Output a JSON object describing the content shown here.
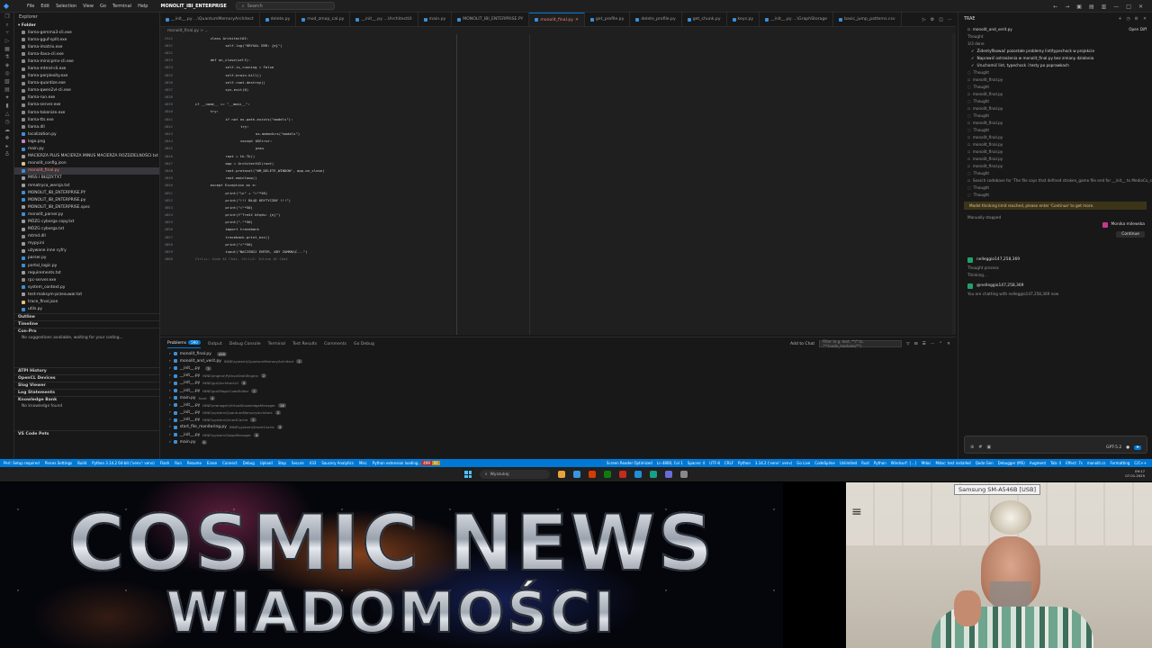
{
  "titlebar": {
    "menu": [
      "File",
      "Edit",
      "Selection",
      "View",
      "Go",
      "Terminal",
      "Help"
    ],
    "active_window": "MONOLIT_IBI_ENTERPRISE",
    "search_placeholder": "Search"
  },
  "explorer": {
    "header": "Explorer",
    "folder": "Folder",
    "files": [
      {
        "name": "llama-gemma3-cli.exe",
        "type": "exe"
      },
      {
        "name": "llama-gguf-split.exe",
        "type": "exe"
      },
      {
        "name": "llama-imatrix.exe",
        "type": "exe"
      },
      {
        "name": "llama-llava-cli.exe",
        "type": "exe"
      },
      {
        "name": "llama-minicpmv-cli.exe",
        "type": "exe"
      },
      {
        "name": "llama-mtmd-cli.exe",
        "type": "exe"
      },
      {
        "name": "llama-perplexity.exe",
        "type": "exe"
      },
      {
        "name": "llama-quantize.exe",
        "type": "exe"
      },
      {
        "name": "llama-qwen2vl-cli.exe",
        "type": "exe"
      },
      {
        "name": "llama-run.exe",
        "type": "exe"
      },
      {
        "name": "llama-server.exe",
        "type": "exe"
      },
      {
        "name": "llama-tokenize.exe",
        "type": "exe"
      },
      {
        "name": "llama-tts.exe",
        "type": "exe"
      },
      {
        "name": "llama.dll",
        "type": "exe"
      },
      {
        "name": "localization.py",
        "type": "py"
      },
      {
        "name": "logo.png",
        "type": "png"
      },
      {
        "name": "main.py",
        "type": "py"
      },
      {
        "name": "MACIERZA PLUS MACIERZA MINUS MACIERZA ROZDZIELNOŚCI.txt",
        "type": "txt"
      },
      {
        "name": "monolit_config.json",
        "type": "json"
      },
      {
        "name": "monolit_final.py",
        "type": "py",
        "selected": true
      },
      {
        "name": "MISS I BŁĘDY.TXT",
        "type": "txt"
      },
      {
        "name": "mmatryca_wersja.txt",
        "type": "txt"
      },
      {
        "name": "MONOLIT_IBI_ENTERPRISE.PY",
        "type": "py"
      },
      {
        "name": "MONOLIT_IBI_ENTERPRISE.py",
        "type": "py"
      },
      {
        "name": "MONOLIT_IBI_ENTERPRISE.spec",
        "type": "txt"
      },
      {
        "name": "monolit_parser.py",
        "type": "py"
      },
      {
        "name": "MÓZG cyborga copy.txt",
        "type": "txt"
      },
      {
        "name": "MÓZG cyborga.txt",
        "type": "txt"
      },
      {
        "name": "mtmd.dll",
        "type": "exe"
      },
      {
        "name": "mypy.ini",
        "type": "txt"
      },
      {
        "name": "używane inne cyfry",
        "type": "txt"
      },
      {
        "name": "parser.py",
        "type": "py"
      },
      {
        "name": "portal_logic.py",
        "type": "py"
      },
      {
        "name": "requirements.txt",
        "type": "txt"
      },
      {
        "name": "rpc-server.exe",
        "type": "exe"
      },
      {
        "name": "system_context.py",
        "type": "py"
      },
      {
        "name": "test-maksym-przesuwar.txt",
        "type": "txt"
      },
      {
        "name": "trace_final.json",
        "type": "json"
      },
      {
        "name": "utils.py",
        "type": "py"
      }
    ],
    "sections": [
      "Outline",
      "Timeline",
      "Con-Pro"
    ],
    "conpro_note": "No suggestions available, waiting for your coding...",
    "lower_sections": [
      "ATPI History",
      "OpenCL Devices",
      "Slog Viewer",
      "Log Statements",
      "Knowledge Bank"
    ],
    "knowledge_note": "No knowledge found",
    "bottom_section": "VS Code Pets"
  },
  "tabs": [
    {
      "label": "__init__.py  ...\\QuantumMemoryArchitect",
      "active": false
    },
    {
      "label": "delete.py",
      "active": false
    },
    {
      "label": "mod_zmap_cal.py",
      "active": false
    },
    {
      "label": "__init__.py  ...\\ArchitectUI",
      "active": false
    },
    {
      "label": "main.py",
      "active": false
    },
    {
      "label": "MONOLIT_IBI_ENTERPRISE.PY",
      "active": false
    },
    {
      "label": "monolit_final.py",
      "active": true
    },
    {
      "label": "get_profile.py",
      "active": false
    },
    {
      "label": "delete_profile.py",
      "active": false
    },
    {
      "label": "get_chunk.py",
      "active": false
    },
    {
      "label": "keys.py",
      "active": false
    },
    {
      "label": "__init__.py  ...\\GraphStorage",
      "active": false
    },
    {
      "label": "basic_jump_patterns.csv",
      "active": false
    }
  ],
  "breadcrumb": "monolit_final.py > ...",
  "code": [
    {
      "ln": "2542",
      "indent": 8,
      "text": "class ArchitectUI:"
    },
    {
      "ln": "4831",
      "indent": 12,
      "text": "self.log(\"KRYSAL ERR: {e}\")"
    },
    {
      "ln": "4832",
      "indent": 0,
      "text": ""
    },
    {
      "ln": "4833",
      "indent": 8,
      "text": "def on_close(self):"
    },
    {
      "ln": "4834",
      "indent": 12,
      "text": "self.is_running = False"
    },
    {
      "ln": "4835",
      "indent": 12,
      "text": "self.brain.kill()"
    },
    {
      "ln": "4836",
      "indent": 12,
      "text": "self.root.destroy()"
    },
    {
      "ln": "4837",
      "indent": 12,
      "text": "sys.exit(0)"
    },
    {
      "ln": "4838",
      "indent": 0,
      "text": ""
    },
    {
      "ln": "4839",
      "indent": 4,
      "text": "if __name__ == \"__main__\":"
    },
    {
      "ln": "4840",
      "indent": 8,
      "text": "try:"
    },
    {
      "ln": "4841",
      "indent": 12,
      "text": "if not os.path.exists(\"models\"):"
    },
    {
      "ln": "4842",
      "indent": 16,
      "text": "try:"
    },
    {
      "ln": "4843",
      "indent": 20,
      "text": "os.makedirs(\"models\")"
    },
    {
      "ln": "4844",
      "indent": 16,
      "text": "except OSError:"
    },
    {
      "ln": "4845",
      "indent": 20,
      "text": "pass"
    },
    {
      "ln": "4846",
      "indent": 12,
      "text": "root = tk.Tk()"
    },
    {
      "ln": "4847",
      "indent": 12,
      "text": "app = ArchitectUI(root)"
    },
    {
      "ln": "4848",
      "indent": 12,
      "text": "root.protocol(\"WM_DELETE_WINDOW\", app.on_close)"
    },
    {
      "ln": "4849",
      "indent": 12,
      "text": "root.mainloop()"
    },
    {
      "ln": "4850",
      "indent": 8,
      "text": "except Exception as e:"
    },
    {
      "ln": "4851",
      "indent": 12,
      "text": "print(\"\\n\" + \"=\"*50)"
    },
    {
      "ln": "4852",
      "indent": 12,
      "text": "print(\"!!! BŁĄD KRYTYCZNY !!!\")"
    },
    {
      "ln": "4853",
      "indent": 12,
      "text": "print(\"=\"*50)"
    },
    {
      "ln": "4854",
      "indent": 12,
      "text": "print(f\"Treść błędu: {e}\")"
    },
    {
      "ln": "4855",
      "indent": 12,
      "text": "print(\"-\"*50)"
    },
    {
      "ln": "4856",
      "indent": 12,
      "text": "import traceback"
    },
    {
      "ln": "4857",
      "indent": 12,
      "text": "traceback.print_exc()"
    },
    {
      "ln": "4858",
      "indent": 12,
      "text": "print(\"=\"*50)"
    },
    {
      "ln": "4859",
      "indent": 12,
      "text": "input(\"NACIŚNIJ ENTER, ABY ZAMKNĄĆ...\")"
    },
    {
      "ln": "4860",
      "indent": 4,
      "text": "Ctrl+L: Side AI Chat, Ctrl+I: Inline AI Chat"
    }
  ],
  "panel": {
    "tabs": [
      "Problems",
      "Output",
      "Debug Console",
      "Terminal",
      "Test Results",
      "Comments",
      "Go Debug"
    ],
    "problems_count": "590",
    "add_to_chat": "Add to Chat",
    "filter_placeholder": "Filter (e.g. text, **/*.ts, !**/node_modules/**)",
    "problems": [
      {
        "file": "monolit_final.py",
        "path": "",
        "count": "499"
      },
      {
        "file": "monolit_and_verit.py",
        "path": "INNE\\system\\QuantumMemoryArchitect",
        "count": "2"
      },
      {
        "file": "__init__.py",
        "path": "",
        "count": "3"
      },
      {
        "file": "__init__.py",
        "path": "INNE\\engine\\PythonShellEngine",
        "count": "2"
      },
      {
        "file": "__init__.py",
        "path": "INNE\\gui\\ArchitectUI",
        "count": "4"
      },
      {
        "file": "__init__.py",
        "path": "INNE\\gui\\MagicCodeEditor",
        "count": "2"
      },
      {
        "file": "main.py",
        "path": "front",
        "count": "4"
      },
      {
        "file": "__init__.py",
        "path": "INNE\\manager\\VirtualKnowledgeManager",
        "count": "16"
      },
      {
        "file": "__init__.py",
        "path": "INNE\\system\\QuantumMemoryArchitect",
        "count": "2"
      },
      {
        "file": "__init__.py",
        "path": "INNE\\system\\SmartCache",
        "count": "2"
      },
      {
        "file": "start_file_monitoring.py",
        "path": "INNE\\system\\SmartCache",
        "count": "4"
      },
      {
        "file": "__init__.py",
        "path": "INNE\\system\\SwapManager",
        "count": "4"
      },
      {
        "file": "main.py",
        "path": "",
        "count": "5"
      }
    ]
  },
  "chat": {
    "title": "TRAE",
    "session_title": "monolit_and_verit.py",
    "open_btn": "Open Diff",
    "thought": "Thought",
    "todo_header": "3/3 done",
    "todos": [
      "Zidentyfikować pozostałe problemy lint/typechock w projekcie",
      "Naprawić ostrzeżenia w monolit_final.py bez zmiany działania",
      "Uruchomić lint, typechock i testy po poprawkach"
    ],
    "activity": [
      "Thought",
      "monolit_final.py",
      "Thought",
      "monolit_final.py",
      "Thought",
      "monolit_final.py",
      "Thought",
      "monolit_final.py",
      "Thought",
      "monolit_final.py",
      "monolit_final.py",
      "monolit_final.py",
      "monolit_final.py",
      "monolit_final.py",
      "Thought",
      "Search codebase for 'The file says that defined stroken_game file end for __init__ to MediaCo_shut_gate'",
      "Thought",
      "Thought"
    ],
    "warning": "Model thinking limit reached, please enter 'Continue' to get more.",
    "stopped": "Manually stopped",
    "user_name": "Monika milewska",
    "user_msg": "Continue",
    "bot_name": "nelleggio147,258,369",
    "thought_process": "Thought process",
    "thinking": "Thinking...",
    "mention_name": "@nelleggio147,258,369",
    "chatting_with": "You are chatting with nelleggio147,258,369 now",
    "model": "GPT-5.2"
  },
  "statusbar": {
    "left": [
      "Perl: Setup required",
      "Pieces Settings",
      "Build",
      "Python 3.14.2 64-bit ('venv': venv)",
      "Flash",
      "Run",
      "Resume",
      "Erase",
      "Connect",
      "Debug",
      "Upload",
      "Stop",
      "Secure",
      "433",
      "Saucery Analytics",
      "Misc",
      "Python extension loading..."
    ],
    "errors": "499",
    "warnings": "91",
    "right": [
      "Screen Reader Optimized",
      "Ln 4860, Col 1",
      "Spaces: 4",
      "UTF-8",
      "CRLF",
      "Python",
      "3.14.2 ('venv': venv)",
      "Go Live",
      "CodeSpline",
      "Unlimited",
      "Rust",
      "Python",
      "Windsurf: {...}",
      "Mdoc",
      "Mdoc: test installed",
      "Qodo Gen",
      "Debugger (MS)",
      "Augment",
      "Tab: 4",
      "Effect: 7s",
      "monolit.cs",
      "Formatting",
      "C/C++"
    ]
  },
  "taskbar": {
    "search_placeholder": "Wyszukaj",
    "time": "09:17",
    "date": "07.01.2025",
    "apps": [
      "#e8a33d",
      "#3a96dd",
      "#d83b01",
      "#0f7b0f",
      "#c42b1c",
      "#1e8fd8",
      "#16a085",
      "#6b6bd6",
      "#888"
    ]
  },
  "overlay": {
    "line1": "COSMIC NEWS",
    "line2": "WIADOMOŚCI"
  },
  "webcam": {
    "device_label": "Samsung SM-A546B [USB]"
  },
  "colors": {
    "accent": "#0078d4",
    "selected_file": "#f48771",
    "warning_bg": "#3c3418"
  }
}
